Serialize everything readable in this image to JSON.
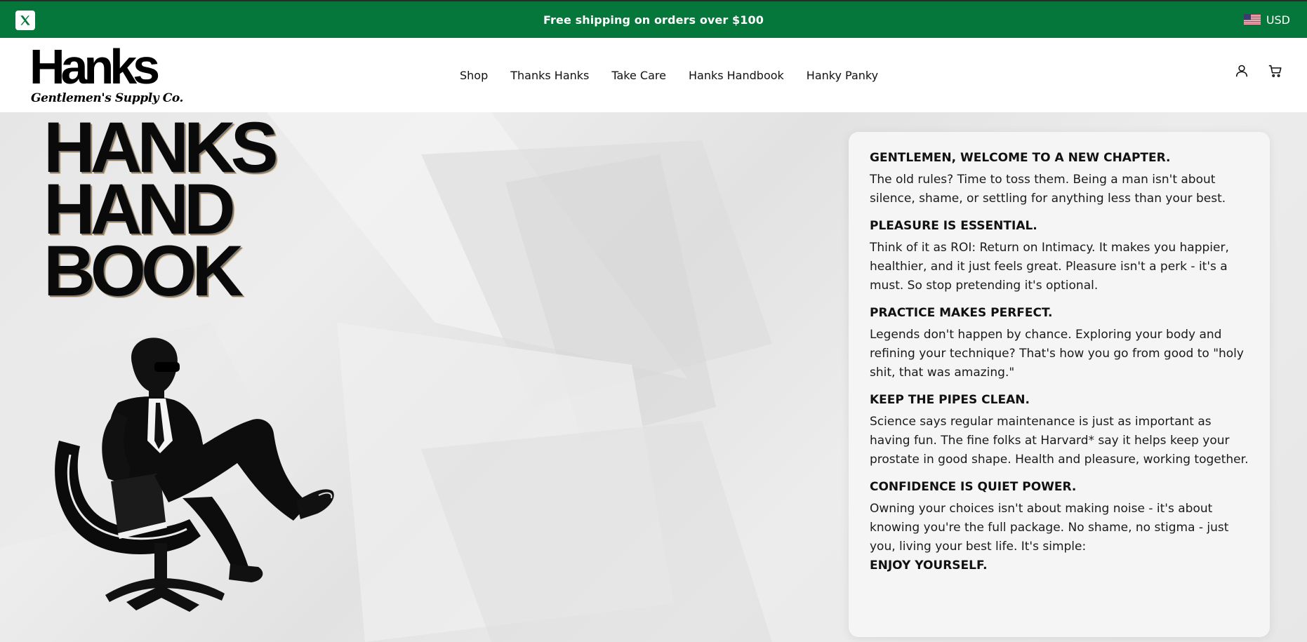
{
  "announcement": {
    "text": "Free shipping on orders over $100",
    "social_icon": "x-icon",
    "currency": "USD",
    "background": "#05773a"
  },
  "header": {
    "brand": {
      "name": "Hanks",
      "tagline": "Gentlemen's Supply Co."
    },
    "nav": [
      {
        "label": "Shop"
      },
      {
        "label": "Thanks Hanks"
      },
      {
        "label": "Take Care"
      },
      {
        "label": "Hanks Handbook"
      },
      {
        "label": "Hanky Panky"
      }
    ],
    "icons": [
      "account-icon",
      "cart-icon"
    ]
  },
  "hero": {
    "title_lines": [
      "HANKS",
      "HAND",
      "BOOK"
    ]
  },
  "card": {
    "sections": [
      {
        "title": "GENTLEMEN, WELCOME TO A NEW CHAPTER.",
        "body": "The old rules? Time to toss them. Being a man isn't about silence, shame, or settling for anything less than your best."
      },
      {
        "title": "PLEASURE IS ESSENTIAL.",
        "body": "Think of it as ROI: Return on Intimacy. It makes you happier, healthier, and it just feels great. Pleasure isn't a perk - it's a must. So stop pretending it's optional."
      },
      {
        "title": "PRACTICE MAKES PERFECT.",
        "body": "Legends don't happen by chance. Exploring your body and refining your technique? That's how you go from good to \"holy shit, that was amazing.\""
      },
      {
        "title": "KEEP THE PIPES CLEAN.",
        "body": "Science says regular maintenance is just as important as having fun. The fine folks at Harvard* say it helps keep your prostate in good shape. Health and pleasure, working together."
      },
      {
        "title": "CONFIDENCE IS QUIET POWER.",
        "body": "Owning your choices isn't about making noise - it's about knowing you're the full package. No shame, no stigma - just you, living your best life. It's simple:",
        "closing": "ENJOY YOURSELF."
      }
    ]
  }
}
